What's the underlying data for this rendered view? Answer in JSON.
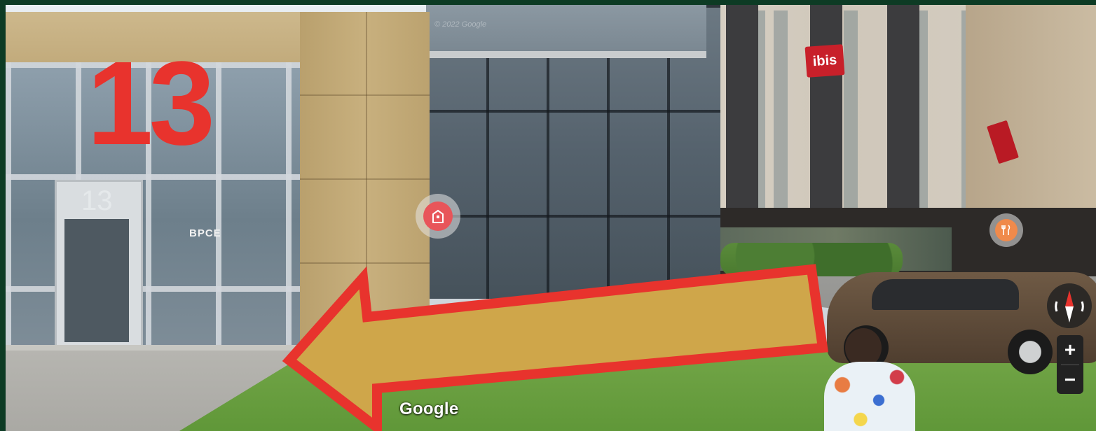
{
  "overlay": {
    "street_number": "13",
    "arrow_direction": "left",
    "arrow_fill": "#cfa64a",
    "arrow_outline": "#e8332d"
  },
  "scene": {
    "door_number": "13",
    "hotel_sign": "ibis",
    "tenant_sign": "BPCE",
    "watermark": "© 2022 Google"
  },
  "markers": [
    {
      "name": "building-marker",
      "icon": "building-icon",
      "color": "#e8555a"
    },
    {
      "name": "restaurant-marker",
      "icon": "fork-knife-icon",
      "color": "#f08a4b"
    }
  ],
  "controls": {
    "zoom_in_label": "+",
    "zoom_out_label": "−",
    "compass_icon": "compass-icon"
  },
  "branding": {
    "logo_text": "Google"
  },
  "colors": {
    "frame": "#0d3b24",
    "overlay_number": "#e8332d"
  }
}
